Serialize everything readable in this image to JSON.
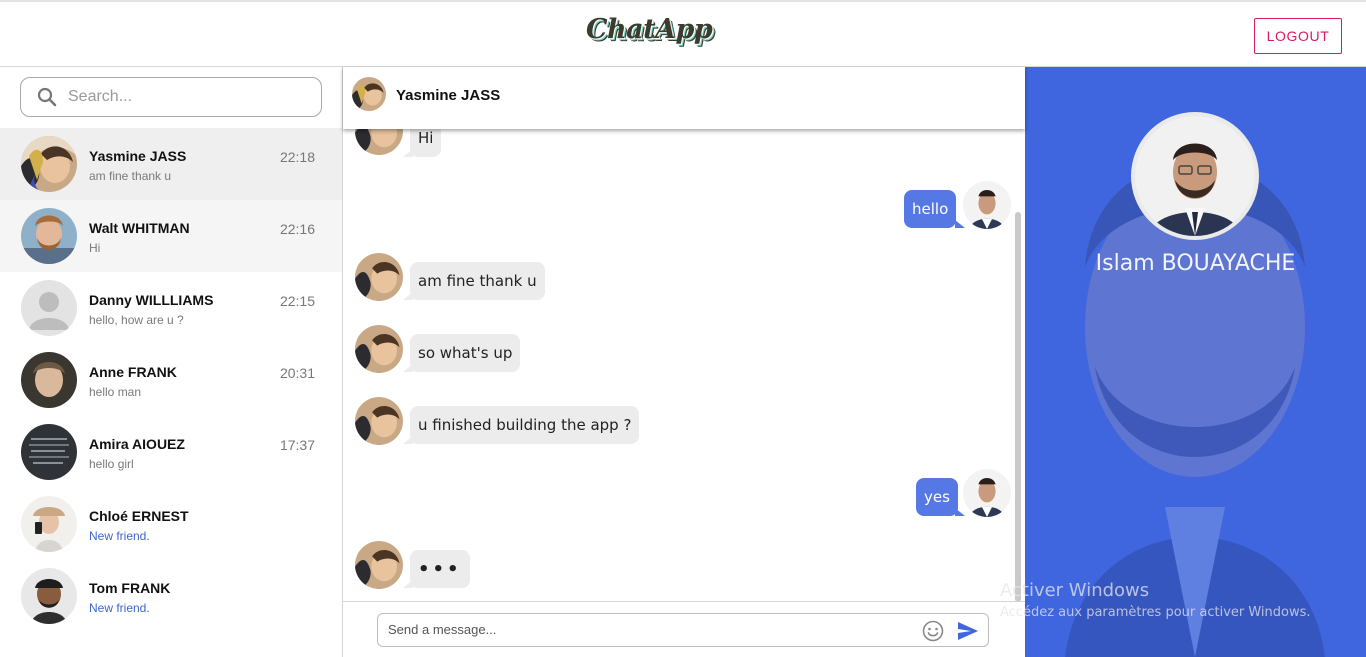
{
  "app": {
    "logo": "ChatApp",
    "logout_label": "LOGOUT"
  },
  "search": {
    "placeholder": "Search..."
  },
  "contacts": [
    {
      "name": "Yasmine JASS",
      "preview": "am fine thank u",
      "time": "22:18",
      "avatar": "yasmine-avatar",
      "state": "active"
    },
    {
      "name": "Walt WHITMAN",
      "preview": "Hi",
      "time": "22:16",
      "avatar": "walt-avatar",
      "state": "hover"
    },
    {
      "name": "Danny WILLLIAMS",
      "preview": "hello, how are u ?",
      "time": "22:15",
      "avatar": "default-user-avatar",
      "state": "normal"
    },
    {
      "name": "Anne FRANK",
      "preview": "hello man",
      "time": "20:31",
      "avatar": "anne-avatar",
      "state": "normal"
    },
    {
      "name": "Amira AIOUEZ",
      "preview": "hello girl",
      "time": "17:37",
      "avatar": "amira-avatar",
      "state": "normal"
    },
    {
      "name": "Chloé ERNEST",
      "preview": "New friend.",
      "time": "",
      "avatar": "chloe-avatar",
      "state": "new"
    },
    {
      "name": "Tom FRANK",
      "preview": "New friend.",
      "time": "",
      "avatar": "tom-avatar",
      "state": "new"
    }
  ],
  "chat": {
    "contact_name": "Yasmine JASS",
    "messages": [
      {
        "from": "them",
        "text": "Hi"
      },
      {
        "from": "me",
        "text": "hello"
      },
      {
        "from": "them",
        "text": "am fine thank u"
      },
      {
        "from": "them",
        "text": "so what's up"
      },
      {
        "from": "them",
        "text": "u finished building the app ?"
      },
      {
        "from": "me",
        "text": "yes"
      },
      {
        "from": "them",
        "text": "•••"
      }
    ],
    "composer_placeholder": "Send a message...",
    "emoji_icon": "smiley-icon",
    "send_icon": "send-icon"
  },
  "profile": {
    "name": "Islam BOUAYACHE"
  },
  "watermark": {
    "line1": "Activer Windows",
    "line2": "Accédez aux paramètres pour activer Windows."
  },
  "colors": {
    "accent": "#3f66de",
    "outgoing_bubble": "#5578e4",
    "logout": "#d81b60"
  }
}
